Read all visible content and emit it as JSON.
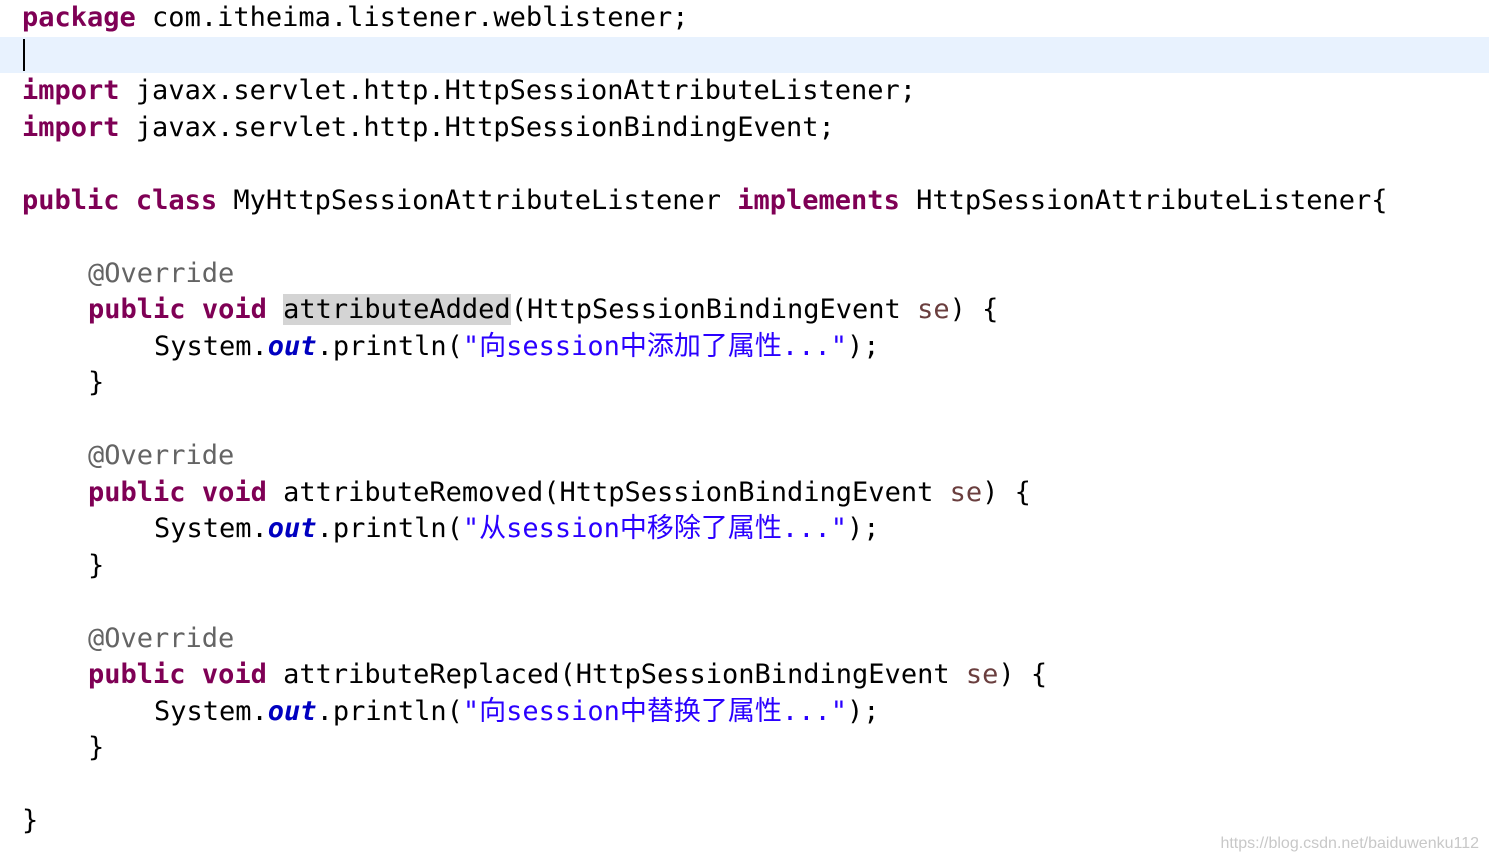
{
  "code": {
    "package_kw": "package",
    "package_name": " com.itheima.listener.weblistener;",
    "import_kw": "import",
    "import1": " javax.servlet.http.HttpSessionAttributeListener;",
    "import2": " javax.servlet.http.HttpSessionBindingEvent;",
    "public_kw": "public",
    "class_kw": "class",
    "class_name": " MyHttpSessionAttributeListener ",
    "implements_kw": "implements",
    "interface_decl": " HttpSessionAttributeListener{",
    "override": "@Override",
    "void_kw": "void",
    "param_type": "(HttpSessionBindingEvent ",
    "param_name": "se",
    "sig_end": ") {",
    "system": "System.",
    "out": "out",
    "println_open": ".println(",
    "println_close": ");",
    "close_brace": "}",
    "methods": [
      {
        "name": "attributeAdded",
        "message": "\"向session中添加了属性...\""
      },
      {
        "name": "attributeRemoved",
        "message": "\"从session中移除了属性...\""
      },
      {
        "name": "attributeReplaced",
        "message": "\"向session中替换了属性...\""
      }
    ]
  },
  "watermark": "https://blog.csdn.net/baiduwenku112",
  "colors": {
    "keyword": "#7f0055",
    "annotation": "#646464",
    "parameter": "#6a3e3e",
    "static_field": "#0000c0",
    "string": "#2a00ff",
    "current_line": "#e8f2fe",
    "occurrence_highlight": "#d4d4d4"
  }
}
